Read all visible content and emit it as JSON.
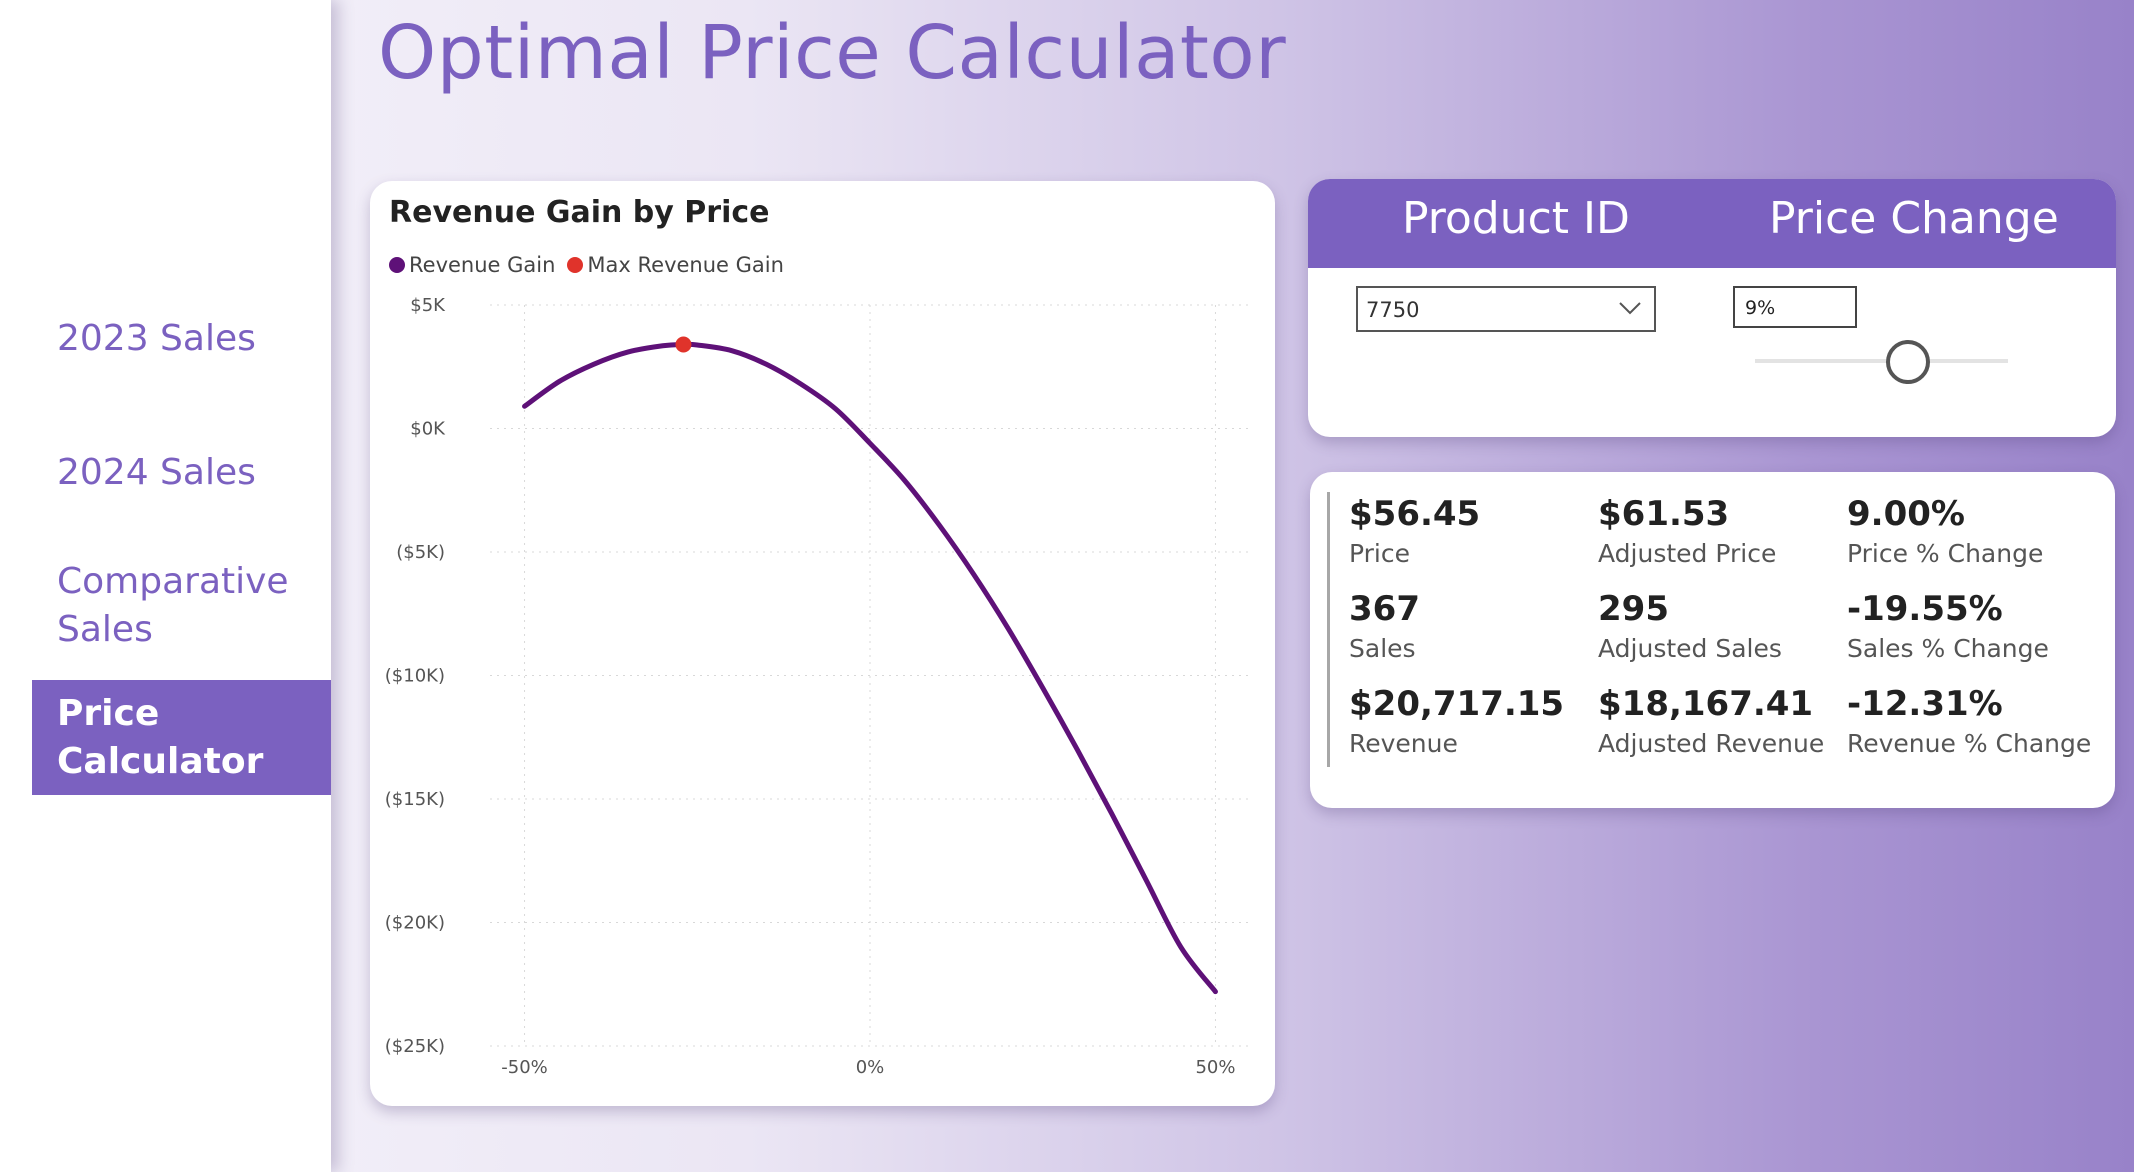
{
  "colors": {
    "accent": "#7b61c0",
    "series_line": "#5e1178",
    "max_point": "#e0332b"
  },
  "sidebar": {
    "items": [
      {
        "label": "2023 Sales"
      },
      {
        "label": "2024 Sales"
      },
      {
        "label": "Comparative Sales"
      },
      {
        "label": "Price Calculator",
        "active": true
      }
    ]
  },
  "page": {
    "title": "Optimal Price Calculator"
  },
  "controls": {
    "product_header": "Product ID",
    "price_header": "Price Change",
    "product_value": "7750",
    "price_change_value": "9%",
    "slider_value_percent": 9,
    "dropdown_icon": "chevron-down-icon"
  },
  "chart_data": {
    "type": "line",
    "title": "Revenue Gain by Price",
    "xlabel": "",
    "ylabel": "",
    "xlim": [
      -55,
      55
    ],
    "ylim": [
      -25000,
      5000
    ],
    "x_ticks": [
      {
        "value": -50,
        "label": "-50%"
      },
      {
        "value": 0,
        "label": "0%"
      },
      {
        "value": 50,
        "label": "50%"
      }
    ],
    "y_ticks": [
      {
        "value": 5000,
        "label": "$5K"
      },
      {
        "value": 0,
        "label": "$0K"
      },
      {
        "value": -5000,
        "label": "($5K)"
      },
      {
        "value": -10000,
        "label": "($10K)"
      },
      {
        "value": -15000,
        "label": "($15K)"
      },
      {
        "value": -20000,
        "label": "($20K)"
      },
      {
        "value": -25000,
        "label": "($25K)"
      }
    ],
    "grid": true,
    "legend_position": "top-left",
    "series": [
      {
        "name": "Revenue Gain",
        "x": [
          -50,
          -45,
          -40,
          -35,
          -30,
          -27,
          -25,
          -20,
          -15,
          -10,
          -5,
          0,
          5,
          10,
          15,
          20,
          25,
          30,
          35,
          40,
          45,
          50
        ],
        "values": [
          900,
          1900,
          2600,
          3100,
          3350,
          3400,
          3380,
          3150,
          2600,
          1800,
          800,
          -600,
          -2100,
          -3900,
          -5900,
          -8100,
          -10500,
          -13000,
          -15600,
          -18300,
          -21000,
          -22800
        ]
      },
      {
        "name": "Max Revenue Gain",
        "x": [
          -27
        ],
        "values": [
          3400
        ]
      }
    ]
  },
  "kpis": [
    {
      "value": "$56.45",
      "label": "Price"
    },
    {
      "value": "$61.53",
      "label": "Adjusted Price"
    },
    {
      "value": "9.00%",
      "label": "Price % Change"
    },
    {
      "value": "367",
      "label": "Sales"
    },
    {
      "value": "295",
      "label": "Adjusted Sales"
    },
    {
      "value": "-19.55%",
      "label": "Sales % Change"
    },
    {
      "value": "$20,717.15",
      "label": "Revenue"
    },
    {
      "value": "$18,167.41",
      "label": "Adjusted Revenue"
    },
    {
      "value": "-12.31%",
      "label": "Revenue % Change"
    }
  ]
}
